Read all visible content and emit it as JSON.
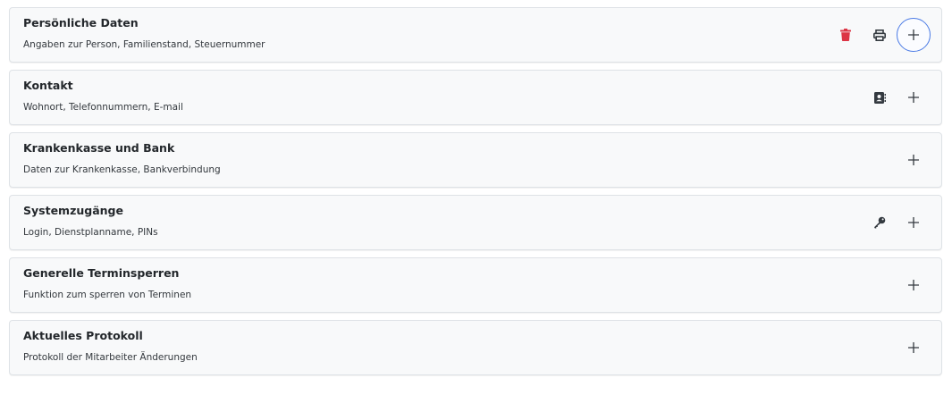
{
  "sections": [
    {
      "title": "Persönliche Daten",
      "subtitle": "Angaben zur Person, Familienstand, Steuernummer",
      "actions": [
        "trash-icon",
        "print-icon"
      ]
    },
    {
      "title": "Kontakt",
      "subtitle": "Wohnort, Telefonnummern, E-mail",
      "actions": [
        "address-book-icon"
      ]
    },
    {
      "title": "Krankenkasse und Bank",
      "subtitle": "Daten zur Krankenkasse, Bankverbindung",
      "actions": []
    },
    {
      "title": "Systemzugänge",
      "subtitle": "Login, Dienstplanname, PINs",
      "actions": [
        "key-icon"
      ]
    },
    {
      "title": "Generelle Terminsperren",
      "subtitle": "Funktion zum sperren von Terminen",
      "actions": []
    },
    {
      "title": "Aktuelles Protokoll",
      "subtitle": "Protokoll der Mitarbeiter Änderungen",
      "actions": []
    }
  ],
  "colors": {
    "trash": "#dc3545",
    "icon": "#343a40",
    "focus_ring": "#4b7be5",
    "panel_bg": "#f8f9fa",
    "panel_border": "#dee2e6"
  },
  "expand_icon": "plus-icon"
}
